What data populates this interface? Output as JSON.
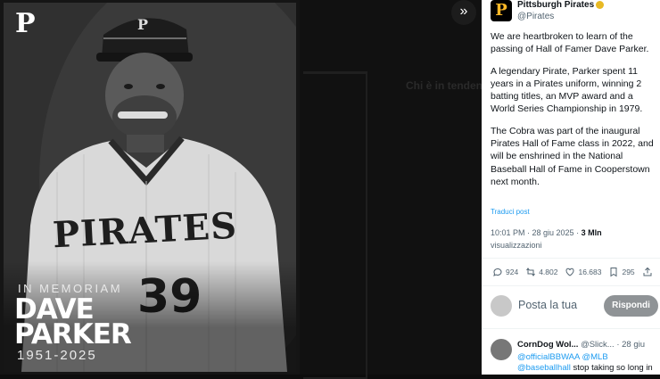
{
  "memorial": {
    "logo": "P",
    "title": "IN MEMORIAM",
    "name_first": "DAVE",
    "name_last": "PARKER",
    "years": "1951-2025",
    "jersey_text": "PIRATES",
    "jersey_number": "39"
  },
  "viewer": {
    "expand_glyph": "»",
    "background_heading": "Chi è in tendenza"
  },
  "tweet": {
    "author": "Pittsburgh Pirates",
    "handle": "@Pirates",
    "avatar_letter": "P",
    "paragraphs": [
      "We are heartbroken to learn of the passing of Hall of Famer Dave Parker.",
      "A legendary Pirate, Parker spent 11 years in a Pirates uniform, winning 2 batting titles, an MVP award and a World Series Championship in 1979.",
      "The Cobra was part of the inaugural Pirates Hall of Fame class in 2022, and will be enshrined in the National Baseball Hall of Fame in Cooperstown next month."
    ],
    "translate_label": "Traduci post",
    "timestamp": "10:01 PM · 28 giu 2025 · ",
    "views_count": "3 Mln",
    "views_label": "visualizzazioni",
    "stats": {
      "replies": "924",
      "reposts": "4.802",
      "likes": "16.683",
      "bookmarks": "295"
    }
  },
  "reply_box": {
    "placeholder": "Posta la tua",
    "button": "Rispondi"
  },
  "comment": {
    "author": "CornDog Wol...",
    "handle": "@Slick...",
    "time": "· 28 giu",
    "mentions": "@officialBBWAA @MLB",
    "line2_mention": "@baseballhall",
    "line2_text": " stop taking so long in"
  },
  "colors": {
    "link": "#1d9bf0",
    "reply_button": "#8f9396",
    "pirates_gold": "#fdb827"
  }
}
